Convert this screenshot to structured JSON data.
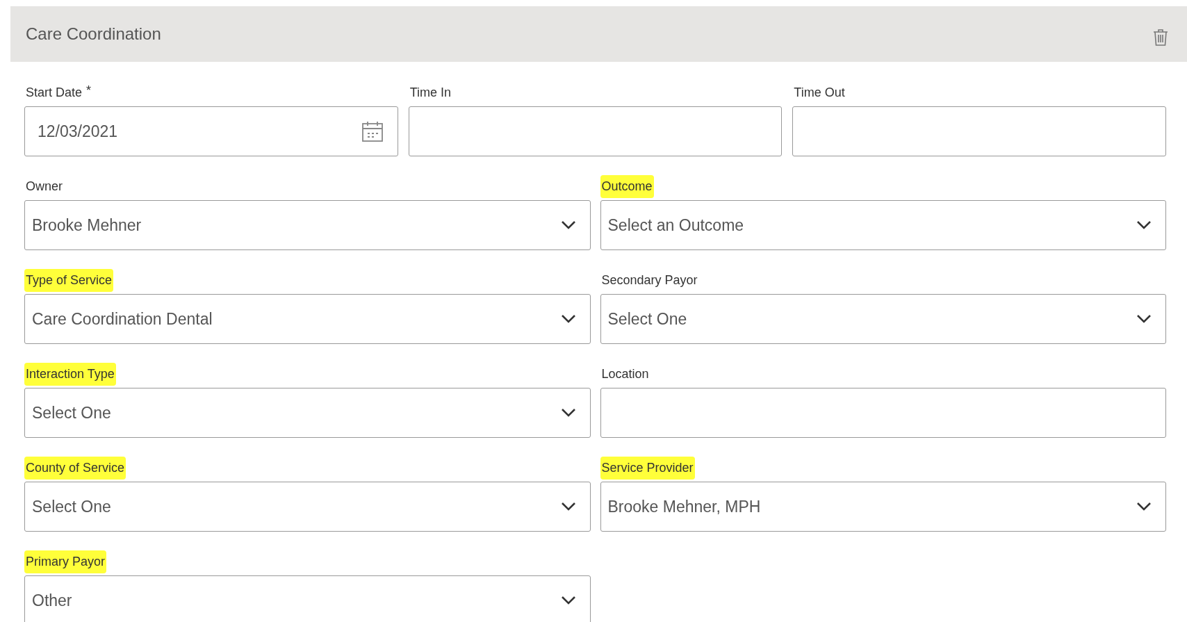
{
  "section": {
    "title": "Care Coordination"
  },
  "rows": [
    {
      "fields": [
        {
          "label": "Start Date",
          "marker": "*",
          "highlighted": false,
          "kind": "date",
          "value": "12/03/2021"
        },
        {
          "label": "Time In",
          "highlighted": false,
          "kind": "text"
        },
        {
          "label": "Time Out",
          "highlighted": false,
          "kind": "text"
        }
      ]
    },
    {
      "fields": [
        {
          "label": "Owner",
          "highlighted": false,
          "kind": "select",
          "value": "Brooke Mehner"
        },
        {
          "label": "Outcome",
          "highlighted": true,
          "kind": "select",
          "value": "Select an Outcome"
        }
      ]
    },
    {
      "fields": [
        {
          "label": "Type of Service",
          "highlighted": true,
          "kind": "select",
          "value": "Care Coordination Dental"
        },
        {
          "label": "Secondary Payor",
          "highlighted": false,
          "kind": "select",
          "value": "Select One"
        }
      ]
    },
    {
      "fields": [
        {
          "label": "Interaction Type",
          "highlighted": true,
          "kind": "select",
          "value": "Select One"
        },
        {
          "label": "Location",
          "highlighted": false,
          "kind": "text"
        }
      ]
    },
    {
      "fields": [
        {
          "label": "County of Service",
          "highlighted": true,
          "kind": "select",
          "value": "Select One"
        },
        {
          "label": "Service Provider",
          "highlighted": true,
          "kind": "select",
          "value": "Brooke Mehner, MPH"
        }
      ]
    },
    {
      "fields": [
        {
          "label": "Primary Payor",
          "highlighted": true,
          "kind": "select",
          "value": "Other"
        }
      ]
    }
  ]
}
